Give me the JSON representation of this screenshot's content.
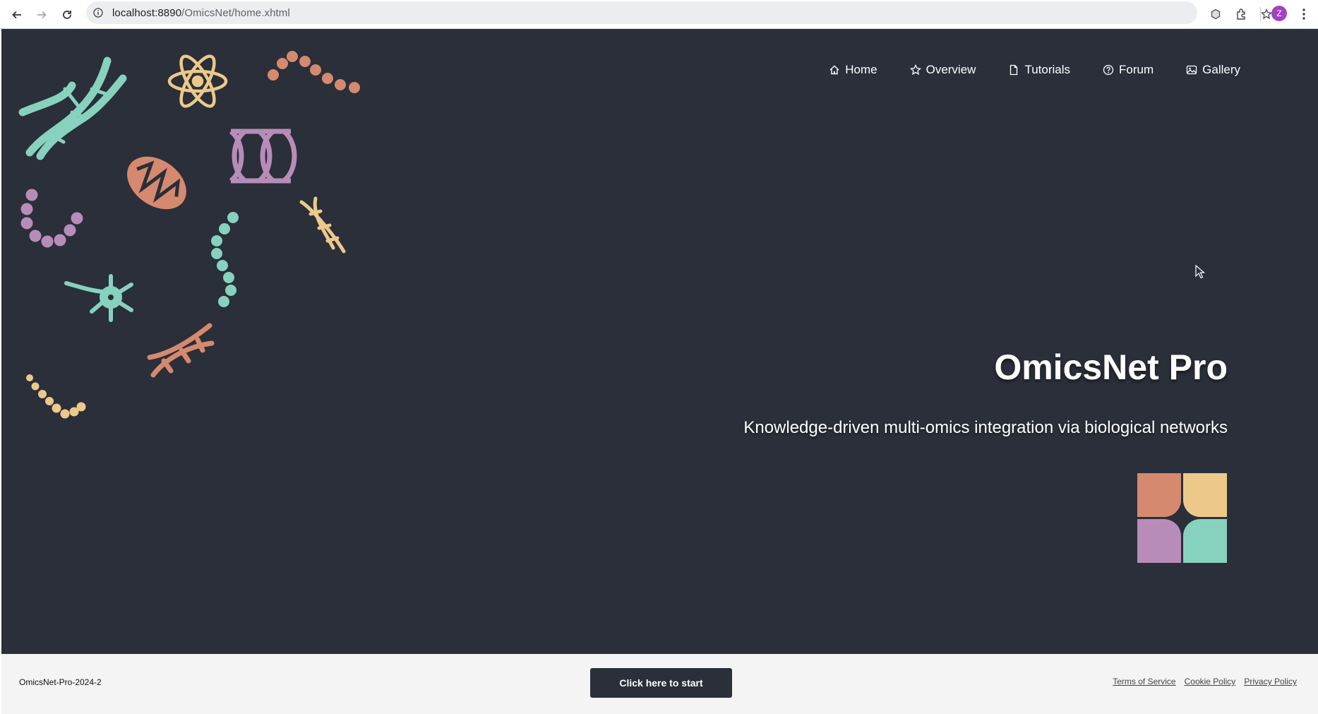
{
  "browser": {
    "url_host": "localhost:8890",
    "url_path": "/OmicsNet/home.xhtml",
    "profile_initial": "Z"
  },
  "nav": {
    "items": [
      {
        "label": "Home",
        "icon": "home-icon"
      },
      {
        "label": "Overview",
        "icon": "star-icon"
      },
      {
        "label": "Tutorials",
        "icon": "document-icon"
      },
      {
        "label": "Forum",
        "icon": "question-circle-icon"
      },
      {
        "label": "Gallery",
        "icon": "image-icon"
      }
    ]
  },
  "hero": {
    "title": "OmicsNet Pro",
    "subtitle": "Knowledge-driven multi-omics integration via biological networks"
  },
  "footer": {
    "version": "OmicsNet-Pro-2024-2",
    "start_button": "Click here to start",
    "links": [
      "Terms of Service",
      "Cookie Policy",
      "Privacy Policy"
    ]
  },
  "colors": {
    "background": "#2a2f3a",
    "teal": "#87d1bf",
    "yellow": "#ecc98a",
    "orange": "#d5896f",
    "purple": "#b88cb8",
    "footer_bg": "#f4f4f4"
  }
}
